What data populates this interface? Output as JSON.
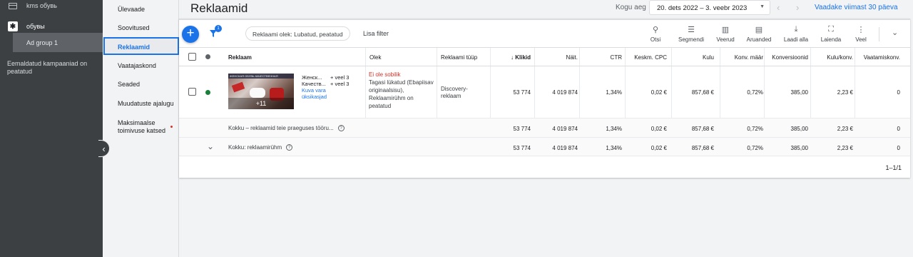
{
  "sidebar": {
    "campaigns": [
      {
        "name": "kms обувь"
      },
      {
        "name": "обувы"
      }
    ],
    "ad_group": "Ad group 1",
    "removed_note": "Eemaldatud kampaaniad on peatatud"
  },
  "nav": {
    "items": [
      {
        "label": "Ülevaade"
      },
      {
        "label": "Soovitused"
      },
      {
        "label": "Reklaamid"
      },
      {
        "label": "Vaatajaskond"
      },
      {
        "label": "Seaded"
      },
      {
        "label": "Muudatuste ajalugu"
      },
      {
        "label": "Maksimaalse toimivuse katsed"
      }
    ]
  },
  "header": {
    "title": "Reklaamid",
    "range_label": "Kogu aeg",
    "date_range": "20. dets 2022 – 3. veebr 2023",
    "view_last": "Vaadake viimast 30 päeva"
  },
  "toolbar": {
    "filter_badge": "1",
    "filter_chip": "Reklaami olek: Lubatud, peatatud",
    "add_filter": "Lisa filter",
    "tools": [
      {
        "label": "Otsi",
        "icon": "search-icon"
      },
      {
        "label": "Segmendi",
        "icon": "segment-icon"
      },
      {
        "label": "Veerud",
        "icon": "columns-icon"
      },
      {
        "label": "Aruanded",
        "icon": "reports-icon"
      },
      {
        "label": "Laadi alla",
        "icon": "download-icon"
      },
      {
        "label": "Laienda",
        "icon": "fullscreen-icon"
      },
      {
        "label": "Veel",
        "icon": "more-icon"
      }
    ]
  },
  "table": {
    "headers": {
      "ad": "Reklaam",
      "status": "Olek",
      "type": "Reklaami tüüp",
      "clicks": "Klikid",
      "impr": "Näit.",
      "ctr": "CTR",
      "cpc": "Keskm. CPC",
      "cost": "Kulu",
      "conv_rate": "Konv. määr",
      "conversions": "Konversioonid",
      "cost_conv": "Kulu/konv.",
      "view_conv": "Vaatamiskonv."
    },
    "ad_row": {
      "thumb_more": "+11",
      "thumb_text": "ЖЕНСКАЯ ОБУВЬ КАЧЕСТВЕННАЯ",
      "headline1": "Женск...",
      "headline1_more": "+ veel 3",
      "headline2": "Качеств...",
      "headline2_more": "+ veel 3",
      "link": "Kuva vara üksikasjad",
      "status_title": "Ei ole sobilik",
      "status_detail": "Tagasi lükatud (Ebapiisav originaalsisu), Reklaamirühm on peatatud",
      "type": "Discovery-reklaam",
      "clicks": "53 774",
      "impr": "4 019 874",
      "ctr": "1,34%",
      "cpc": "0,02 €",
      "cost": "857,68 €",
      "conv_rate": "0,72%",
      "conversions": "385,00",
      "cost_conv": "2,23 €",
      "view_conv": "0"
    },
    "total_filter": {
      "label": "Kokku – reklaamid teie praeguses tööru...",
      "clicks": "53 774",
      "impr": "4 019 874",
      "ctr": "1,34%",
      "cpc": "0,02 €",
      "cost": "857,68 €",
      "conv_rate": "0,72%",
      "conversions": "385,00",
      "cost_conv": "2,23 €",
      "view_conv": "0"
    },
    "total_group": {
      "label": "Kokku: reklaamirühm",
      "clicks": "53 774",
      "impr": "4 019 874",
      "ctr": "1,34%",
      "cpc": "0,02 €",
      "cost": "857,68 €",
      "conv_rate": "0,72%",
      "conversions": "385,00",
      "cost_conv": "2,23 €",
      "view_conv": "0"
    },
    "pagination": "1–1/1"
  },
  "colors": {
    "accent": "#1a73e8",
    "sidebar_bg": "#3c4043",
    "error": "#d93025",
    "enabled": "#188038"
  }
}
